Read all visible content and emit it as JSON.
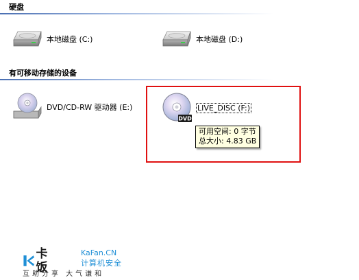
{
  "groups": {
    "hard_disks": {
      "title": "硬盘",
      "drives": [
        {
          "label": "本地磁盘 (C:)",
          "icon": "hard-drive-icon"
        },
        {
          "label": "本地磁盘 (D:)",
          "icon": "hard-drive-icon"
        }
      ]
    },
    "removable": {
      "title": "有可移动存储的设备",
      "drives": [
        {
          "label": "DVD/CD-RW 驱动器 (E:)",
          "icon": "dvd-drive-icon"
        },
        {
          "label": "LIVE_DISC (F:)",
          "icon": "dvd-disc-icon",
          "badge": "DVD"
        }
      ]
    }
  },
  "tooltip": {
    "line1": "可用空间: 0 字节",
    "line2": "总大小: 4.83 GB"
  },
  "watermark": {
    "logo_cn": "卡饭",
    "logo_en": "KaFan.CN",
    "logo_sub": "计算机安全",
    "slogan": "互助分享  大气谦和"
  },
  "colors": {
    "highlight_box": "#e01010",
    "tooltip_bg": "#ffffe1",
    "group_line": "#4a6fb2",
    "logo_blue": "#1f8fd6"
  }
}
